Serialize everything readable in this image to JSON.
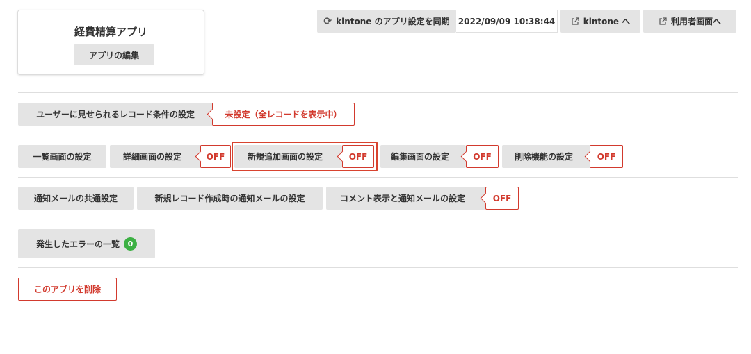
{
  "app": {
    "name": "経費精算アプリ",
    "edit_label": "アプリの編集"
  },
  "header": {
    "sync_label": "kintone のアプリ設定を同期",
    "sync_timestamp": "2022/09/09 10:38:44",
    "kintone_link_label": "kintone へ",
    "user_screen_link_label": "利用者画面へ"
  },
  "record_conditions": {
    "label": "ユーザーに見せられるレコード条件の設定",
    "status": "未設定（全レコードを表示中）"
  },
  "screen_settings": {
    "list_label": "一覧画面の設定",
    "detail_label": "詳細画面の設定",
    "detail_status": "OFF",
    "new_label": "新規追加画面の設定",
    "new_status": "OFF",
    "edit_label": "編集画面の設定",
    "edit_status": "OFF",
    "delete_label": "削除機能の設定",
    "delete_status": "OFF"
  },
  "notifications": {
    "common_label": "通知メールの共通設定",
    "new_record_label": "新規レコード作成時の通知メールの設定",
    "comment_label": "コメント表示と通知メールの設定",
    "comment_status": "OFF"
  },
  "errors": {
    "label": "発生したエラーの一覧",
    "count": "0"
  },
  "danger": {
    "delete_app_label": "このアプリを削除"
  },
  "colors": {
    "accent_red": "#d23a2e",
    "button_gray": "#e4e4e4",
    "success_green": "#3cb043"
  },
  "icons": {
    "sync": "refresh-icon",
    "external": "external-link-icon"
  }
}
